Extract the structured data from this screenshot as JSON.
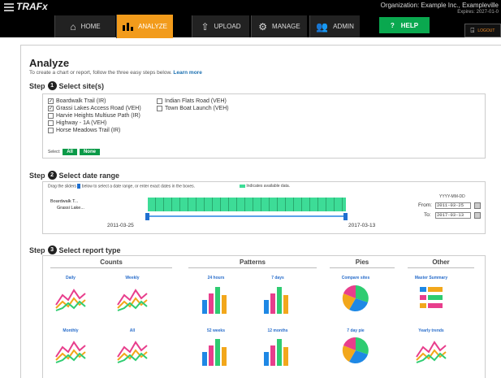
{
  "app": {
    "name": "TRAFx",
    "org": "Organization: Example Inc., Exampleville",
    "expires": "Expires: 2027-01-0"
  },
  "nav": [
    {
      "label": "HOME",
      "icon": "home-icon"
    },
    {
      "label": "ANALYZE",
      "icon": "bar-chart-icon"
    },
    {
      "label": "UPLOAD",
      "icon": "upload-icon"
    },
    {
      "label": "MANAGE",
      "icon": "gears-icon"
    },
    {
      "label": "ADMIN",
      "icon": "users-icon"
    }
  ],
  "help": {
    "label": "HELP",
    "icon": "?"
  },
  "logout": {
    "label": "LOGOUT"
  },
  "page": {
    "title": "Analyze",
    "intro": "To create a chart or report, follow the three easy steps below.",
    "learn_more": "Learn more"
  },
  "step_word": "Step",
  "step1": {
    "num": "1",
    "title": "Select site(s)",
    "sites": [
      {
        "name": "Boardwalk Trail (IR)",
        "checked": true
      },
      {
        "name": "Grassi Lakes Access Road (VEH)",
        "checked": true
      },
      {
        "name": "Harvie Heights Multiuse Path (IR)",
        "checked": false
      },
      {
        "name": "Highway - 1A (VEH)",
        "checked": false
      },
      {
        "name": "Horse Meadows Trail (IR)",
        "checked": false
      },
      {
        "name": "Indian Flats Road (VEH)",
        "checked": false
      },
      {
        "name": "Town Boat Launch (VEH)",
        "checked": false
      }
    ],
    "select_label": "Select:",
    "all": "All",
    "none": "None"
  },
  "step2": {
    "num": "2",
    "title": "Select date range",
    "hint1": "Drag the sliders",
    "hint2": "below to select a date range, or enter exact dates in the boxes.",
    "legend": "Indicates available data.",
    "rows": [
      "Boardwalk T...",
      "Grassi Lake..."
    ],
    "start": "2011-03-25",
    "end": "2017-03-13",
    "format": "YYYY-MM-DD",
    "from_label": "From:",
    "to_label": "To:",
    "from": "2011-03-25",
    "to": "2017-03-13"
  },
  "step3": {
    "num": "3",
    "title": "Select report type",
    "categories": [
      "Counts",
      "Patterns",
      "Pies",
      "Other"
    ],
    "reports": [
      "Daily",
      "Weekly",
      "24 hours",
      "7 days",
      "Compare sites",
      "Master Summary",
      "Monthly",
      "All",
      "52 weeks",
      "12 months",
      "7 day pie",
      "Yearly trends"
    ]
  },
  "colors": {
    "accent": "#f29b1b",
    "green": "#0a9a48",
    "link": "#2a6ecb"
  }
}
